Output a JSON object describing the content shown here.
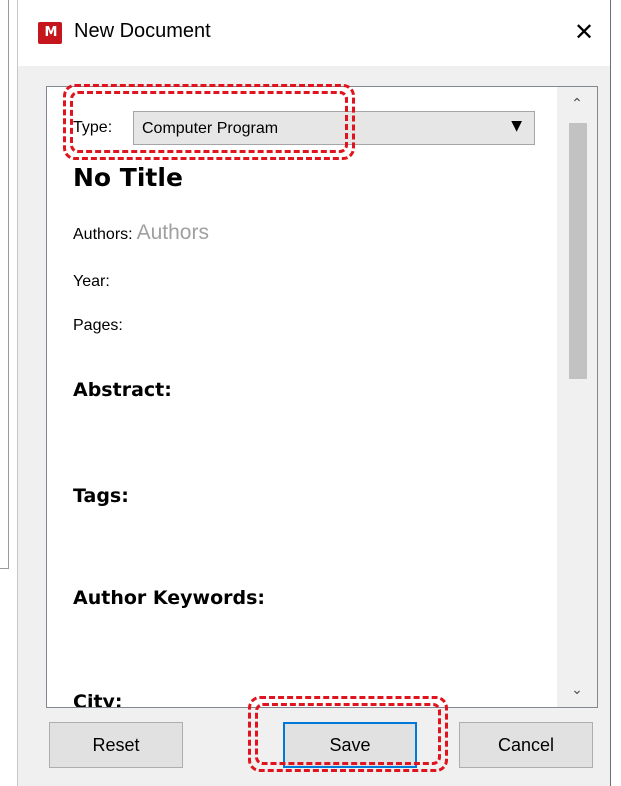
{
  "background": {
    "right_edge_color": "#6f6f6f"
  },
  "dialog": {
    "app_icon": "mendeley-logo-icon",
    "app_icon_glyph": "M",
    "title": "New Document",
    "close_glyph": "✕"
  },
  "form": {
    "type_label": "Type:",
    "type_value": "Computer Program",
    "dropdown_glyph": "▼",
    "doc_title": "No Title",
    "authors_label": "Authors:",
    "authors_placeholder": "Authors",
    "year_label": "Year:",
    "pages_label": "Pages:",
    "sections": {
      "abstract": "Abstract:",
      "tags": "Tags:",
      "author_keywords": "Author Keywords:",
      "city": "City:"
    }
  },
  "scrollbar": {
    "up_glyph": "⌃",
    "down_glyph": "⌄"
  },
  "buttons": {
    "reset": "Reset",
    "save": "Save",
    "cancel": "Cancel"
  },
  "annotations": {
    "color": "#e0141e",
    "style": "dashed"
  }
}
